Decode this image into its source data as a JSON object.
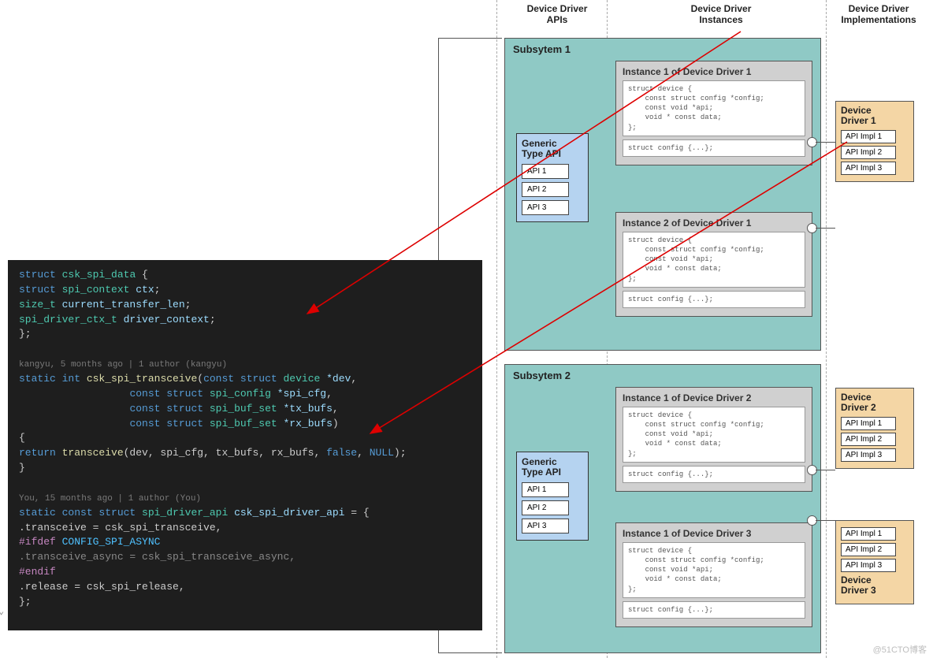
{
  "headers": {
    "apis": "Device Driver\nAPIs",
    "instances": "Device Driver\nInstances",
    "impl": "Device Driver\nImplementations"
  },
  "subsystems": [
    {
      "label": "Subsytem 1",
      "api": {
        "title": "Generic\nType API",
        "items": [
          "API 1",
          "API 2",
          "API 3"
        ]
      },
      "instances": [
        {
          "title": "Instance 1 of Device Driver 1",
          "code1": "struct device {\n    const struct config *config;\n    const void *api;\n    void * const data;\n};",
          "code2": "struct config {...};"
        },
        {
          "title": "Instance 2 of Device Driver 1",
          "code1": "struct device {\n    const struct config *config;\n    const void *api;\n    void * const data;\n};",
          "code2": "struct config {...};"
        }
      ],
      "drivers": [
        {
          "title": "Device\nDriver 1",
          "items": [
            "API Impl 1",
            "API Impl 2",
            "API Impl 3"
          ]
        }
      ]
    },
    {
      "label": "Subsytem 2",
      "api": {
        "title": "Generic\nType API",
        "items": [
          "API 1",
          "API 2",
          "API 3"
        ]
      },
      "instances": [
        {
          "title": "Instance 1 of Device Driver 2",
          "code1": "struct device {\n    const struct config *config;\n    const void *api;\n    void * const data;\n};",
          "code2": "struct config {...};"
        },
        {
          "title": "Instance 1 of Device Driver 3",
          "code1": "struct device {\n    const struct config *config;\n    const void *api;\n    void * const data;\n};",
          "code2": "struct config {...};"
        }
      ],
      "drivers": [
        {
          "title": "Device\nDriver 2",
          "items": [
            "API Impl 1",
            "API Impl 2",
            "API Impl 3"
          ]
        },
        {
          "title": "Device\nDriver 3",
          "items": [
            "API Impl 1",
            "API Impl 2",
            "API Impl 3"
          ]
        }
      ]
    }
  ],
  "editor": {
    "struct_kw": "struct",
    "struct_name": "csk_spi_data",
    "open": " {",
    "close": "};",
    "m1a": "    struct ",
    "m1b": "spi_context",
    "m1c": " ctx",
    "m2a": "    size_t ",
    "m2b": "current_transfer_len",
    "m3a": "    spi_driver_ctx_t ",
    "m3b": "driver_context",
    "semi": ";",
    "blame1": "kangyu, 5 months ago | 1 author (kangyu)",
    "fka": "static ",
    "fkb": "int ",
    "fname": "csk_spi_transceive",
    "paren": "(",
    "p1a": "const ",
    "p1b": "struct ",
    "p1c": "device ",
    "p1d": "*dev",
    "p2c": "spi_config ",
    "p2d": "*spi_cfg",
    "p3c": "spi_buf_set ",
    "p3d": "*tx_bufs",
    "p4d": "*rx_bufs",
    "cparen": ")",
    "ob": "{",
    "cb": "}",
    "ret": "    return ",
    "tfn": "transceive",
    "targs": "(dev, spi_cfg, tx_bufs, rx_bufs, ",
    "tf": "false",
    ", ": ", ",
    "tn": "NULL",
    ");": ");",
    "blame2": "You, 15 months ago | 1 author (You)",
    "gka": "static ",
    "gkb": "const ",
    "gkc": "struct ",
    "gty": "spi_driver_api",
    " ": " ",
    "gname": "csk_spi_driver_api",
    " = {": " = {",
    "a1": "    .transceive = csk_spi_transceive,",
    "ifdef": "#ifdef ",
    "macro": "CONFIG_SPI_ASYNC",
    "a2": "    .transceive_async = csk_spi_transceive_async,",
    "endif": "#endif",
    "a3": "    .release = csk_spi_release,"
  },
  "watermark": "@51CTO博客",
  "chevron": "⌄"
}
